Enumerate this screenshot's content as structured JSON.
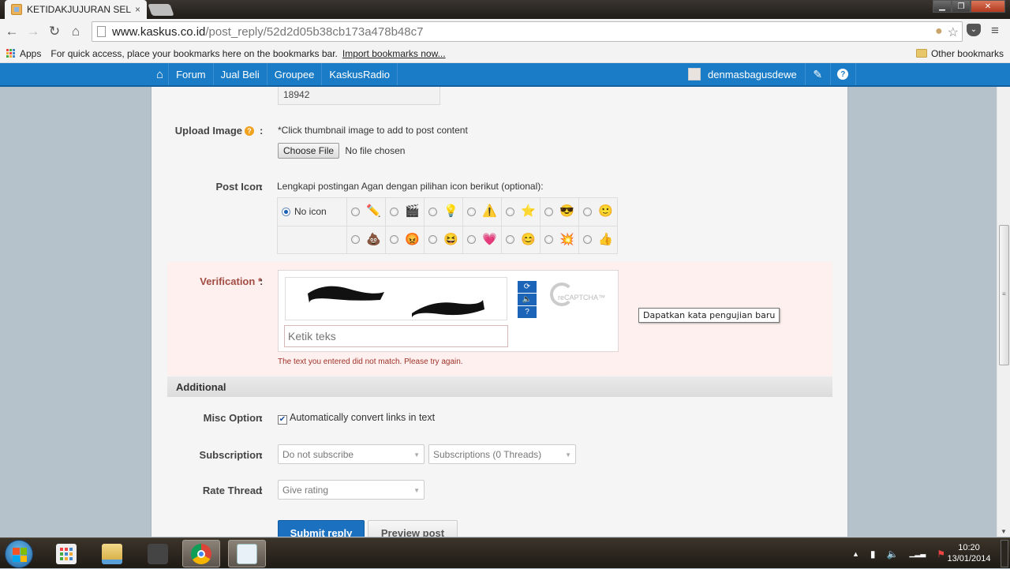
{
  "browser": {
    "tab_title": "KETIDAKJUJURAN SELLER",
    "tab_close": "×",
    "url_host": "www.kaskus.co.id",
    "url_path": "/post_reply/52d2d05b38cb173a478b48c7",
    "bookmarks": {
      "apps_label": "Apps",
      "hint": "For quick access, place your bookmarks here on the bookmarks bar.",
      "import_link": "Import bookmarks now...",
      "other": "Other bookmarks"
    }
  },
  "nav": {
    "items": [
      "Forum",
      "Jual Beli",
      "Groupee",
      "KaskusRadio"
    ],
    "username": "denmasbagusdewe"
  },
  "form": {
    "top_value": "18942",
    "upload_image": {
      "label": "Upload Image",
      "hint": "*Click thumbnail image to add to post content",
      "button": "Choose File",
      "status": "No file chosen"
    },
    "post_icon": {
      "label": "Post Icon",
      "hint": "Lengkapi postingan Agan dengan pilihan icon berikut (optional):",
      "no_icon_label": "No icon",
      "selected": "No icon",
      "row1": [
        "pencil",
        "clapperboard",
        "lightbulb",
        "warning",
        "star",
        "cool",
        "smile"
      ],
      "row2": [
        "poop",
        "angry",
        "laugh",
        "heart",
        "blush",
        "explode",
        "thumbs-up"
      ]
    },
    "verification": {
      "label": "Verification",
      "required_mark": "*",
      "input_placeholder": "Ketik teks",
      "tooltip": "Dapatkan kata pengujian baru",
      "recaptcha_text": "reCAPTCHA™",
      "error": "The text you entered did not match. Please try again."
    },
    "additional": {
      "header": "Additional",
      "misc_label": "Misc Option",
      "misc_checkbox": "Automatically convert links in text",
      "misc_checked": true,
      "subscription_label": "Subscription",
      "subscription_value": "Do not subscribe",
      "subscriptions_folder": "Subscriptions (0 Threads)",
      "rate_label": "Rate Thread",
      "rate_value": "Give rating"
    },
    "submit_label": "Submit reply",
    "preview_label": "Preview post",
    "colon": ":"
  },
  "taskbar": {
    "time": "10:20",
    "date": "13/01/2014"
  }
}
